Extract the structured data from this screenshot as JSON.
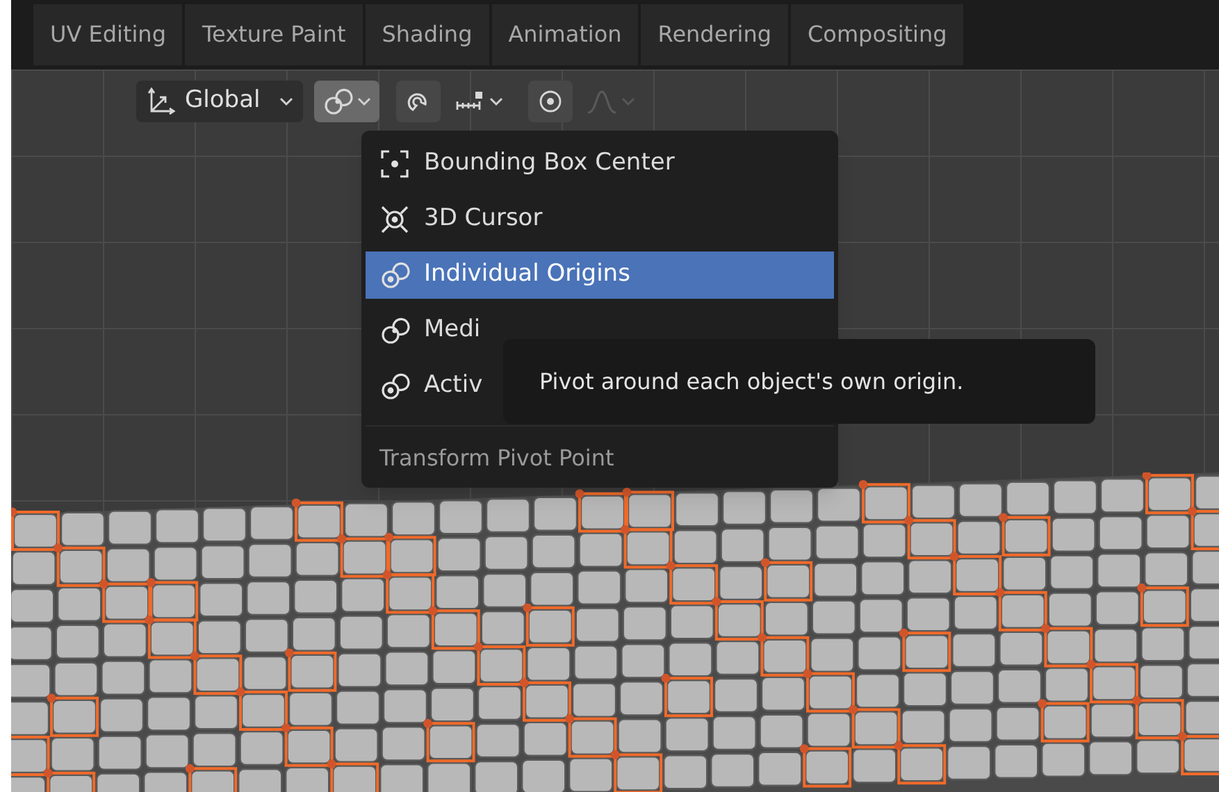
{
  "workspace_tabs": [
    {
      "label": "UV Editing",
      "selected": false
    },
    {
      "label": "Texture Paint",
      "selected": false
    },
    {
      "label": "Shading",
      "selected": false
    },
    {
      "label": "Animation",
      "selected": false
    },
    {
      "label": "Rendering",
      "selected": false
    },
    {
      "label": "Compositing",
      "selected": false
    }
  ],
  "toolbar": {
    "orientation": {
      "label": "Global"
    },
    "buttons": [
      {
        "kind": "pivot",
        "active": true,
        "disabled": false,
        "dropdown": true
      },
      {
        "kind": "snap",
        "active": false,
        "disabled": false,
        "dropdown": false
      },
      {
        "kind": "snap_target",
        "active": false,
        "disabled": false,
        "dropdown": true
      },
      {
        "kind": "proportional",
        "active": false,
        "disabled": false,
        "dropdown": false
      },
      {
        "kind": "falloff",
        "active": false,
        "disabled": true,
        "dropdown": true
      }
    ]
  },
  "pivot_menu": {
    "items": [
      {
        "label": "Bounding Box Center",
        "kind": "bbox",
        "selected": false
      },
      {
        "label": "3D Cursor",
        "kind": "cursor",
        "selected": false
      },
      {
        "label": "Individual Origins",
        "kind": "individual",
        "selected": true
      },
      {
        "label": "Medi",
        "kind": "median",
        "selected": false
      },
      {
        "label": "Activ",
        "kind": "active",
        "selected": false
      }
    ],
    "title": "Transform Pivot Point"
  },
  "tooltip": {
    "text": "Pivot around each object's own origin."
  }
}
